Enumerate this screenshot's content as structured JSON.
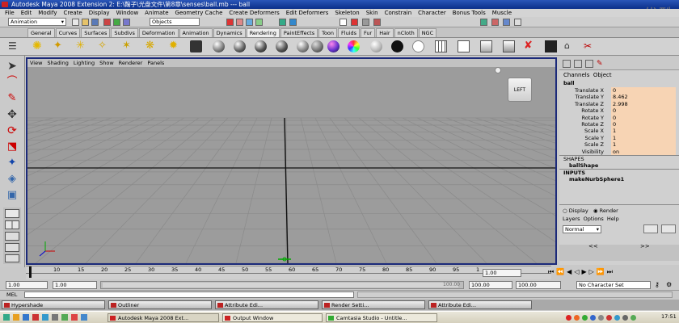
{
  "window": {
    "title": "Autodesk Maya 2008 Extension 2: E:\\鞠子\\光盘文件\\第8章\\senses\\ball.mb  ---  ball"
  },
  "watermark": "优酷",
  "menu": [
    "File",
    "Edit",
    "Modify",
    "Create",
    "Display",
    "Window",
    "Animate",
    "Geometry Cache",
    "Create Deformers",
    "Edit Deformers",
    "Skeleton",
    "Skin",
    "Constrain",
    "Character",
    "Bonus Tools",
    "Muscle"
  ],
  "statusline": {
    "mode": "Animation",
    "selection_mode": "Objects"
  },
  "shelf_tabs": [
    "General",
    "Curves",
    "Surfaces",
    "Subdivs",
    "Deformation",
    "Animation",
    "Dynamics",
    "Rendering",
    "PaintEffects",
    "Toon",
    "Fluids",
    "Fur",
    "Hair",
    "nCloth",
    "NGC"
  ],
  "shelf_active": "Rendering",
  "viewport": {
    "menu": [
      "View",
      "Shading",
      "Lighting",
      "Show",
      "Renderer",
      "Panels"
    ],
    "view_cube_label": "LEFT"
  },
  "channel_box": {
    "tabs": [
      "Channels",
      "Object"
    ],
    "object_name": "ball",
    "channels": [
      {
        "label": "Translate X",
        "value": "0"
      },
      {
        "label": "Translate Y",
        "value": "8.462"
      },
      {
        "label": "Translate Z",
        "value": "2.998"
      },
      {
        "label": "Rotate X",
        "value": "0"
      },
      {
        "label": "Rotate Y",
        "value": "0"
      },
      {
        "label": "Rotate Z",
        "value": "0"
      },
      {
        "label": "Scale X",
        "value": "1"
      },
      {
        "label": "Scale Y",
        "value": "1"
      },
      {
        "label": "Scale Z",
        "value": "1"
      },
      {
        "label": "Visibility",
        "value": "on"
      }
    ],
    "shapes_header": "SHAPES",
    "shape_name": "ballShape",
    "inputs_header": "INPUTS",
    "input_name": "makeNurbSphere1"
  },
  "layer_editor": {
    "display_label": "Display",
    "render_label": "Render",
    "menu": [
      "Layers",
      "Options",
      "Help"
    ],
    "blend_mode": "Normal"
  },
  "timeline": {
    "ticks": [
      "10",
      "15",
      "20",
      "25",
      "30",
      "35",
      "40",
      "45",
      "50",
      "55",
      "60",
      "65",
      "70",
      "75",
      "80",
      "85",
      "90",
      "95",
      "1"
    ],
    "current_frame": "1.00"
  },
  "range": {
    "start_time": "1.00",
    "playback_start": "1.00",
    "playback_end_label": "100.00",
    "end_time": "100.00",
    "end_playback": "100.00",
    "character_set": "No Character Set"
  },
  "command_line": {
    "label": "MEL"
  },
  "minimized_windows": [
    "Hypershade",
    "Outliner",
    "Attribute Edi...",
    "Render Setti...",
    "Attribute Edi..."
  ],
  "taskbar": {
    "items": [
      "Autodesk Maya 2008 Ext...",
      "Output Window",
      "Camtasia Studio - Untitle..."
    ],
    "clock": "17:51"
  }
}
